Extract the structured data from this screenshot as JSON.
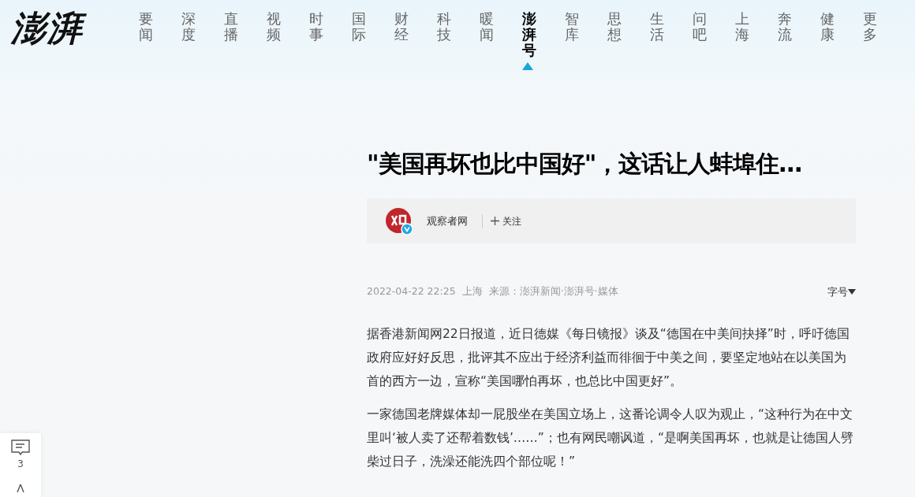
{
  "logo": "澎湃",
  "nav": [
    {
      "label": "要闻",
      "selected": false
    },
    {
      "label": "深度",
      "selected": false
    },
    {
      "label": "直播",
      "selected": false
    },
    {
      "label": "视频",
      "selected": false
    },
    {
      "label": "时事",
      "selected": false
    },
    {
      "label": "国际",
      "selected": false
    },
    {
      "label": "财经",
      "selected": false
    },
    {
      "label": "科技",
      "selected": false
    },
    {
      "label": "暖闻",
      "selected": false
    },
    {
      "label": "澎湃号",
      "selected": true
    },
    {
      "label": "智库",
      "selected": false
    },
    {
      "label": "思想",
      "selected": false
    },
    {
      "label": "生活",
      "selected": false
    },
    {
      "label": "问吧",
      "selected": false
    },
    {
      "label": "上海",
      "selected": false
    },
    {
      "label": "奔流",
      "selected": false
    },
    {
      "label": "健康",
      "selected": false
    },
    {
      "label": "更多",
      "selected": false
    }
  ],
  "article": {
    "title": "\"美国再坏也比中国好\"，这话让人蚌埠住…",
    "author": {
      "name": "观察者网",
      "verified": true,
      "follow": "关注"
    },
    "meta": {
      "time": "2022-04-22 22:25",
      "location": "上海",
      "source": "来源：澎湃新闻·澎湃号·媒体"
    },
    "font_size": "字号",
    "paragraphs": [
      "据香港新闻网22日报道，近日德媒《每日镜报》谈及“德国在中美间抉择”时，呼吁德国政府应好好反思，批评其不应出于经济利益而徘徊于中美之间，要坚定地站在以美国为首的西方一边，宣称“美国哪怕再坏，也总比中国更好”。",
      "一家德国老牌媒体却一屁股坐在美国立场上，这番论调令人叹为观止，“这种行为在中文里叫‘被人卖了还帮着数钱’……”；也有网民嘲讽道，“是啊美国再坏，也就是让德国人劈柴过日子，洗澡还能洗四个部位呢！”"
    ]
  },
  "side": {
    "comment_count": "3"
  }
}
